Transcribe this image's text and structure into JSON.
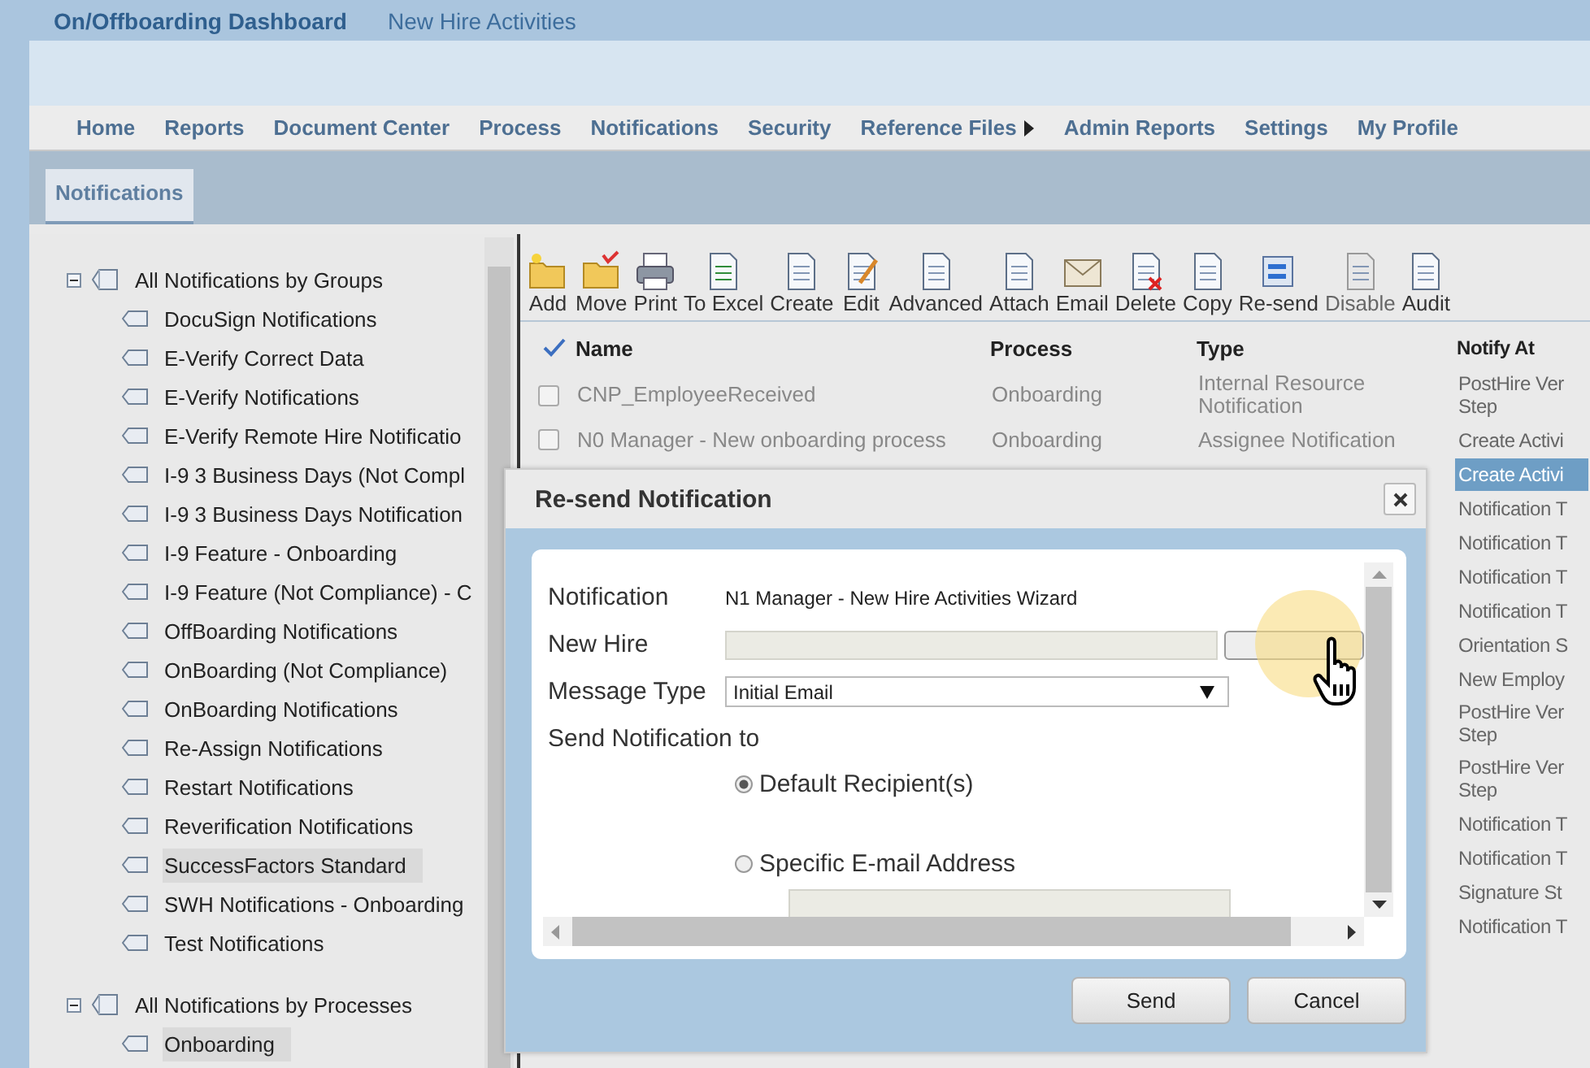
{
  "header": {
    "title": "On/Offboarding Dashboard",
    "subtitle": "New Hire Activities"
  },
  "nav": [
    {
      "label": "Home",
      "has_submenu": false
    },
    {
      "label": "Reports",
      "has_submenu": false
    },
    {
      "label": "Document Center",
      "has_submenu": false
    },
    {
      "label": "Process",
      "has_submenu": false
    },
    {
      "label": "Notifications",
      "has_submenu": false
    },
    {
      "label": "Security",
      "has_submenu": false
    },
    {
      "label": "Reference Files",
      "has_submenu": true
    },
    {
      "label": "Admin Reports",
      "has_submenu": false
    },
    {
      "label": "Settings",
      "has_submenu": false
    },
    {
      "label": "My Profile",
      "has_submenu": false
    }
  ],
  "tabs": [
    {
      "label": "Notifications",
      "selected": true
    }
  ],
  "tree": [
    {
      "label": "All Notifications by Groups",
      "expanded": true,
      "children": [
        {
          "label": "DocuSign Notifications",
          "selected": false
        },
        {
          "label": "E-Verify Correct Data",
          "selected": false
        },
        {
          "label": "E-Verify Notifications",
          "selected": false
        },
        {
          "label": "E-Verify Remote Hire Notificatio",
          "selected": false
        },
        {
          "label": "I-9 3 Business Days (Not Compl",
          "selected": false
        },
        {
          "label": "I-9 3 Business Days Notification",
          "selected": false
        },
        {
          "label": "I-9 Feature - Onboarding",
          "selected": false
        },
        {
          "label": "I-9 Feature (Not Compliance) - C",
          "selected": false
        },
        {
          "label": "OffBoarding Notifications",
          "selected": false
        },
        {
          "label": "OnBoarding (Not Compliance)",
          "selected": false
        },
        {
          "label": "OnBoarding Notifications",
          "selected": false
        },
        {
          "label": "Re-Assign Notifications",
          "selected": false
        },
        {
          "label": "Restart Notifications",
          "selected": false
        },
        {
          "label": "Reverification Notifications",
          "selected": false
        },
        {
          "label": "SuccessFactors Standard",
          "selected": true
        },
        {
          "label": "SWH Notifications - Onboarding",
          "selected": false
        },
        {
          "label": "Test Notifications",
          "selected": false
        }
      ]
    },
    {
      "label": "All Notifications by Processes",
      "expanded": true,
      "children": [
        {
          "label": "Onboarding",
          "selected": true
        }
      ]
    }
  ],
  "toolbar": [
    {
      "label": "Add",
      "disabled": false
    },
    {
      "label": "Move",
      "disabled": false
    },
    {
      "label": "Print",
      "disabled": false
    },
    {
      "label": "To Excel",
      "disabled": false
    },
    {
      "label": "Create",
      "disabled": false
    },
    {
      "label": "Edit",
      "disabled": false
    },
    {
      "label": "Advanced",
      "disabled": false
    },
    {
      "label": "Attach",
      "disabled": false
    },
    {
      "label": "Email",
      "disabled": false
    },
    {
      "label": "Delete",
      "disabled": false
    },
    {
      "label": "Copy",
      "disabled": false
    },
    {
      "label": "Re-send",
      "disabled": false
    },
    {
      "label": "Disable",
      "disabled": true
    },
    {
      "label": "Audit",
      "disabled": false
    }
  ],
  "table": {
    "columns": [
      "Name",
      "Process",
      "Type",
      "Notify At"
    ],
    "rows": [
      {
        "name": "CNP_EmployeeReceived",
        "process": "Onboarding",
        "type": "Internal Resource\nNotification",
        "notify_at": "PostHire Ver\nStep",
        "checked": false,
        "selected": false
      },
      {
        "name": "N0 Manager - New onboarding process",
        "process": "Onboarding",
        "type": "Assignee Notification",
        "notify_at": "Create Activi",
        "checked": false,
        "selected": false
      },
      {
        "notify_at": "Create Activi",
        "selected": true
      },
      {
        "notify_at": "Notification T",
        "selected": false
      },
      {
        "notify_at": "Notification T",
        "selected": false
      },
      {
        "notify_at": "Notification T",
        "selected": false
      },
      {
        "notify_at": "Notification T",
        "selected": false
      },
      {
        "notify_at": "Orientation S",
        "selected": false
      },
      {
        "notify_at": "New Employ",
        "selected": false
      },
      {
        "notify_at": "PostHire Ver\nStep",
        "selected": false
      },
      {
        "notify_at": "PostHire Ver\nStep",
        "selected": false
      },
      {
        "notify_at": "Notification T",
        "selected": false
      },
      {
        "notify_at": "Notification T",
        "selected": false
      },
      {
        "notify_at": "Signature St",
        "selected": false
      },
      {
        "notify_at": "Notification T",
        "selected": false
      }
    ]
  },
  "dialog": {
    "title": "Re-send Notification",
    "notification": {
      "label": "Notification",
      "value": "N1 Manager - New Hire Activities Wizard"
    },
    "new_hire": {
      "label": "New Hire"
    },
    "message_type": {
      "label": "Message Type",
      "value": "Initial Email"
    },
    "send_to_label": "Send Notification to",
    "recipients": [
      {
        "label": "Default Recipient(s)",
        "selected": true
      },
      {
        "label": "Specific E-mail Address",
        "selected": false
      }
    ],
    "buttons": [
      "Send",
      "Cancel"
    ]
  }
}
